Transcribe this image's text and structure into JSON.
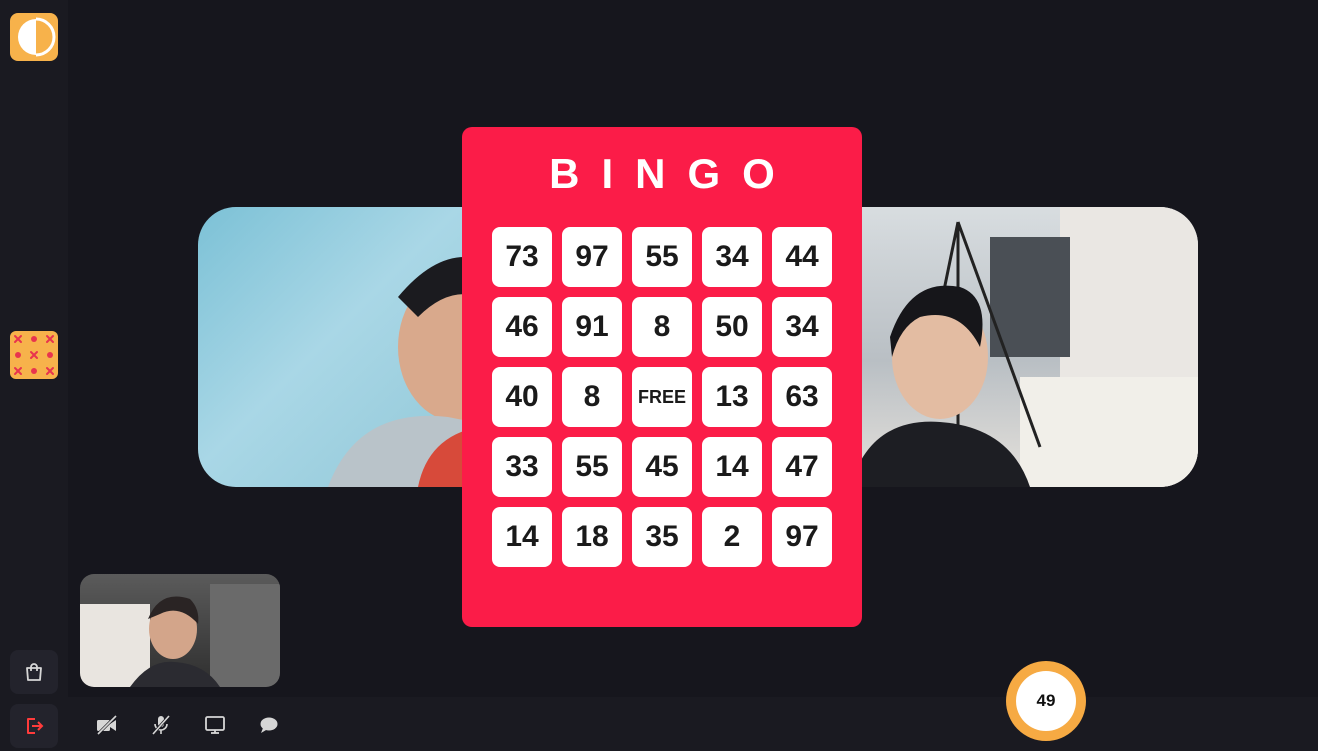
{
  "sidebar": {
    "logo_icon": "half-moon-logo-icon",
    "game_icon": "tic-tac-toe-icon",
    "shop_icon": "shopping-bag-icon",
    "leave_icon": "logout-icon"
  },
  "bingo": {
    "title": "BINGO",
    "cells": [
      "73",
      "97",
      "55",
      "34",
      "44",
      "46",
      "91",
      "8",
      "50",
      "34",
      "40",
      "8",
      "FREE",
      "13",
      "63",
      "33",
      "55",
      "45",
      "14",
      "47",
      "14",
      "18",
      "35",
      "2",
      "97"
    ]
  },
  "controls": {
    "icons": [
      "camera-off-icon",
      "mic-off-icon",
      "screen-share-icon",
      "chat-icon"
    ]
  },
  "counter": {
    "value": "49"
  },
  "colors": {
    "background": "#16161d",
    "card": "#fb1c48",
    "accent": "#f7b24b",
    "leave": "#ff3b3b"
  }
}
